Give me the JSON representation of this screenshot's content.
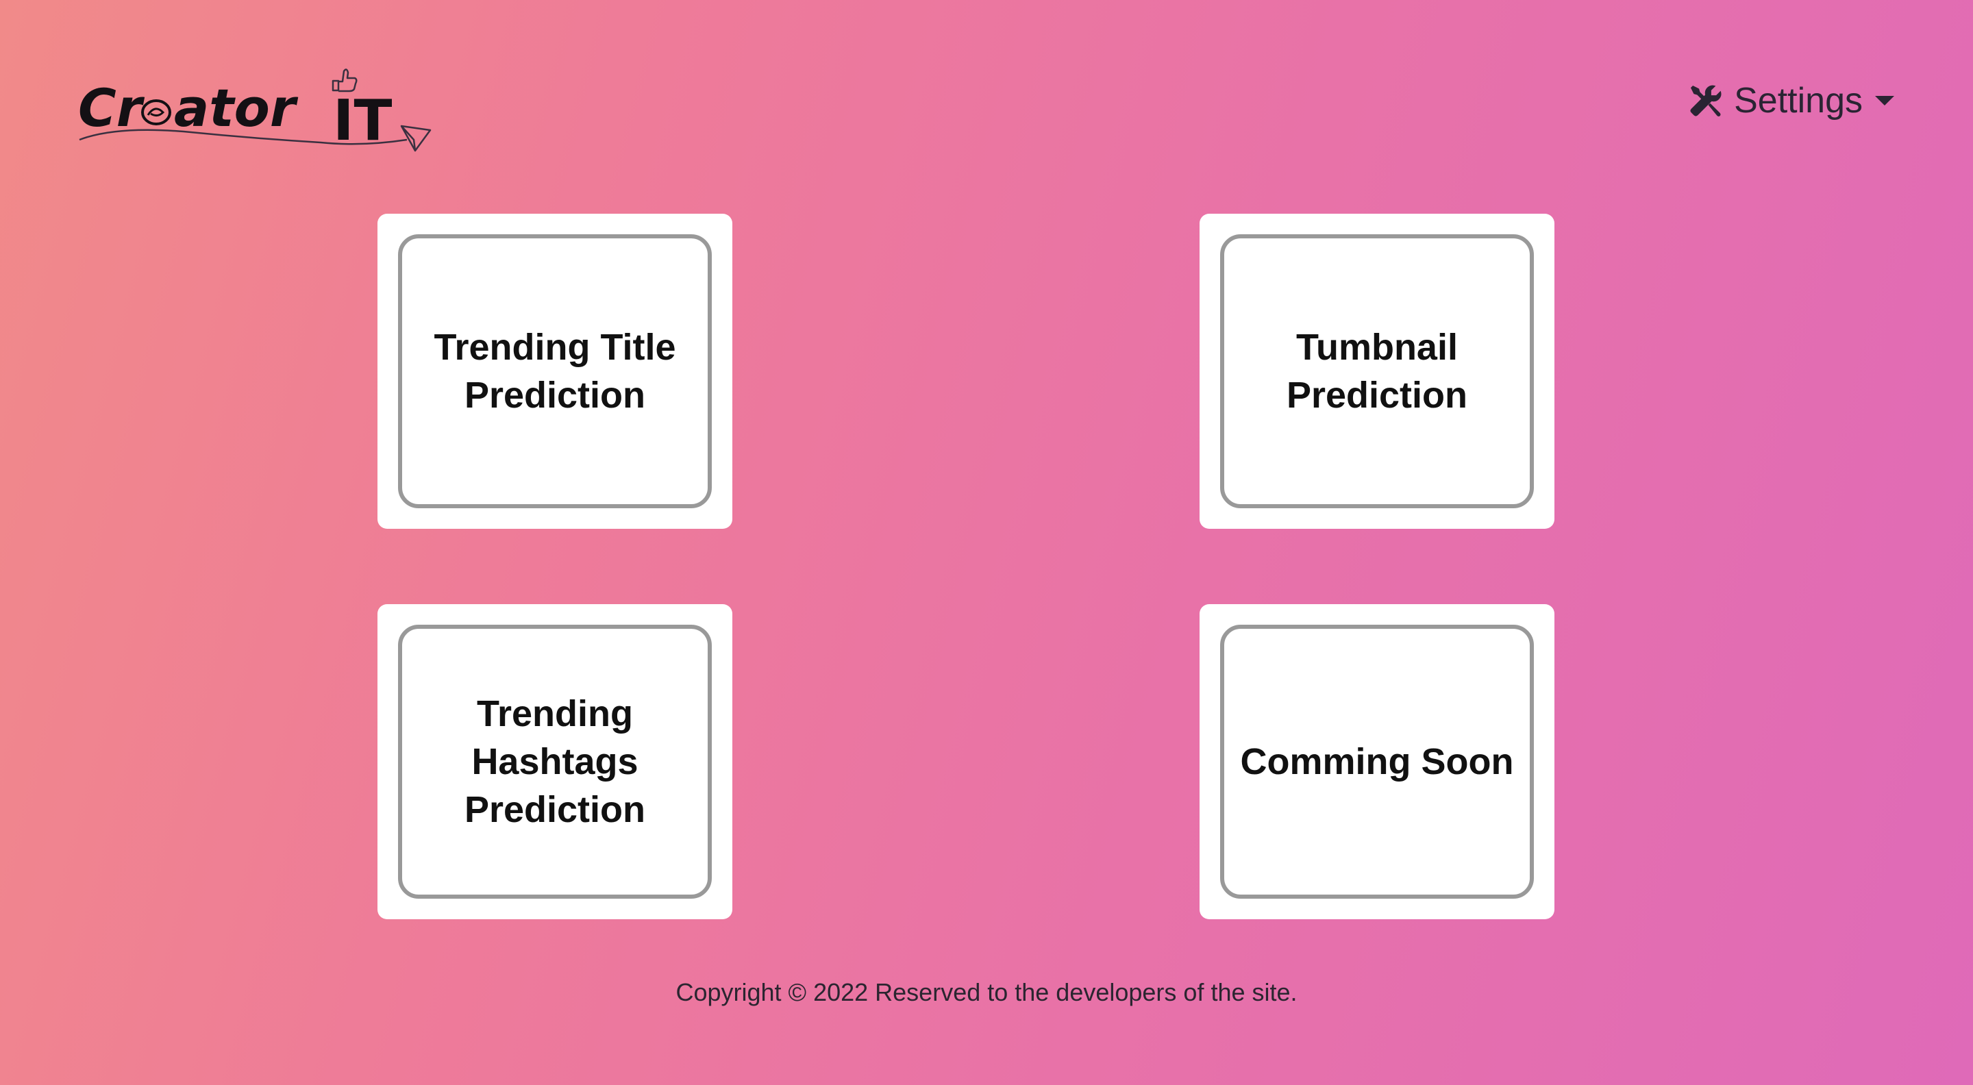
{
  "header": {
    "logo": {
      "text_left": "Cr",
      "text_mid": "ator",
      "text_right": "IT",
      "alt": "Creator IT"
    },
    "settings": {
      "label": "Settings",
      "icon": "tools-icon"
    }
  },
  "cards": [
    {
      "title_line1": "Trending Title",
      "title_line2": "Prediction",
      "title_line3": ""
    },
    {
      "title_line1": "Tumbnail",
      "title_line2": "Prediction",
      "title_line3": ""
    },
    {
      "title_line1": "Trending",
      "title_line2": "Hashtags",
      "title_line3": "Prediction"
    },
    {
      "title_line1": "Comming Soon",
      "title_line2": "",
      "title_line3": ""
    }
  ],
  "footer": {
    "copyright": "Copyright © 2022 Reserved to the developers of the site."
  },
  "colors": {
    "gradient_start": "#f18a89",
    "gradient_end": "#df6ab8",
    "card_bg": "#ffffff",
    "card_border": "#999999"
  }
}
